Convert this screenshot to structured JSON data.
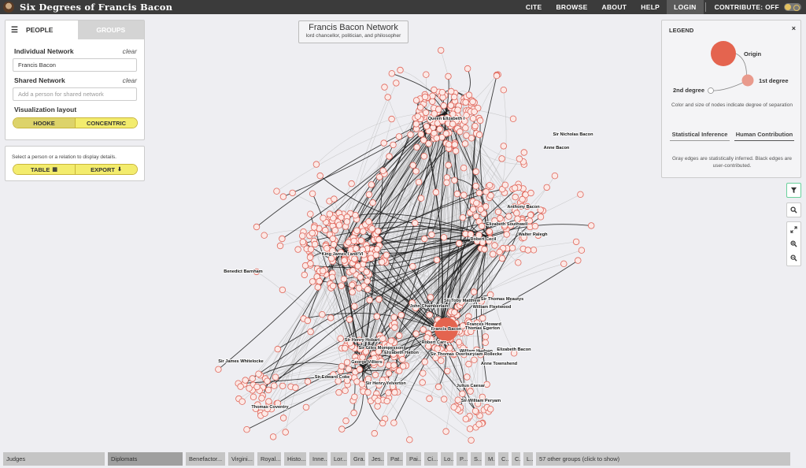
{
  "app": {
    "title": "Six Degrees of Francis Bacon"
  },
  "nav": {
    "cite": "CITE",
    "browse": "BROWSE",
    "about": "ABOUT",
    "help": "HELP",
    "login": "LOGIN",
    "contribute": "CONTRIBUTE: OFF"
  },
  "network": {
    "title": "Francis Bacon Network",
    "subtitle": "lord chancellor, politician, and philosopher",
    "colors": {
      "node_fill": "#fce9e6",
      "node_stroke": "#e0665a",
      "origin": "#e4644f",
      "edge_gray": "#b7b7b7",
      "edge_black": "#1b1b1b"
    },
    "labels": [
      "Queen Elizabeth I",
      "Sir Nicholas Bacon",
      "Anne Bacon",
      "Anthony Bacon",
      "Elizabeth Southwell",
      "Walter Ralegh",
      "Robert Cecil",
      "King James I and VI",
      "Benedict Barnham",
      "Sir Toby Matthew",
      "Sir Thomas Meautys",
      "John Chamberlain",
      "William Fleetwood",
      "Francis Bacon",
      "Frances Howard",
      "Thomas Egerton",
      "Sir Henry Hobart",
      "Robert Carr",
      "Sir Giles Mompesson",
      "William Hudson",
      "Elizabeth Hatton",
      "William Rollecke",
      "Elizabeth Bacon",
      "Sir Thomas Overbury",
      "Sir James Whitelocke",
      "George Villiers",
      "Anne Townshend",
      "Sir Edward Coke",
      "Sir Henry Yelverton",
      "Julius Caesar",
      "Sir William Peryam",
      "Thomas Coventry"
    ]
  },
  "sidebar": {
    "tabs": {
      "people": "PEOPLE",
      "groups": "GROUPS"
    },
    "individual_label": "Individual Network",
    "individual_clear": "clear",
    "individual_value": "Francis Bacon",
    "shared_label": "Shared Network",
    "shared_clear": "clear",
    "shared_placeholder": "Add a person for shared network",
    "layout_label": "Visualization layout",
    "layout_hooke": "HOOKE",
    "layout_concentric": "CONCENTRIC"
  },
  "details": {
    "text": "Select a person or a relation to display details.",
    "table": "TABLE",
    "export": "EXPORT"
  },
  "legend": {
    "title": "LEGEND",
    "close": "×",
    "origin": "Origin",
    "first_degree": "1st degree",
    "second_degree": "2nd degree",
    "desc": "Color and size of nodes indicate degree of separation",
    "tab_left": "Statistical Inference",
    "tab_right": "Human Contribution",
    "desc2": "Gray edges are statistically inferred. Black edges are user-contributed.",
    "colors": {
      "origin": "#e4644f",
      "first": "#e99a8c",
      "second": "#ffffff"
    }
  },
  "tools": {
    "filter": "filter-icon",
    "search": "search-icon",
    "reset": "reset-view-icon",
    "zoom_in": "zoom-in-icon",
    "zoom_out": "zoom-out-icon"
  },
  "groups_bar": {
    "chips": [
      "Judges",
      "Diplomats",
      "Benefactor...",
      "Virgini...",
      "Royal...",
      "Histo...",
      "Inne...",
      "Lor...",
      "Gra...",
      "Jes...",
      "Pat...",
      "Pai...",
      "Ci...",
      "Lo...",
      "P...",
      "S...",
      "M...",
      "C...",
      "C...",
      "L..."
    ],
    "more": "57 other groups (click to show)"
  }
}
